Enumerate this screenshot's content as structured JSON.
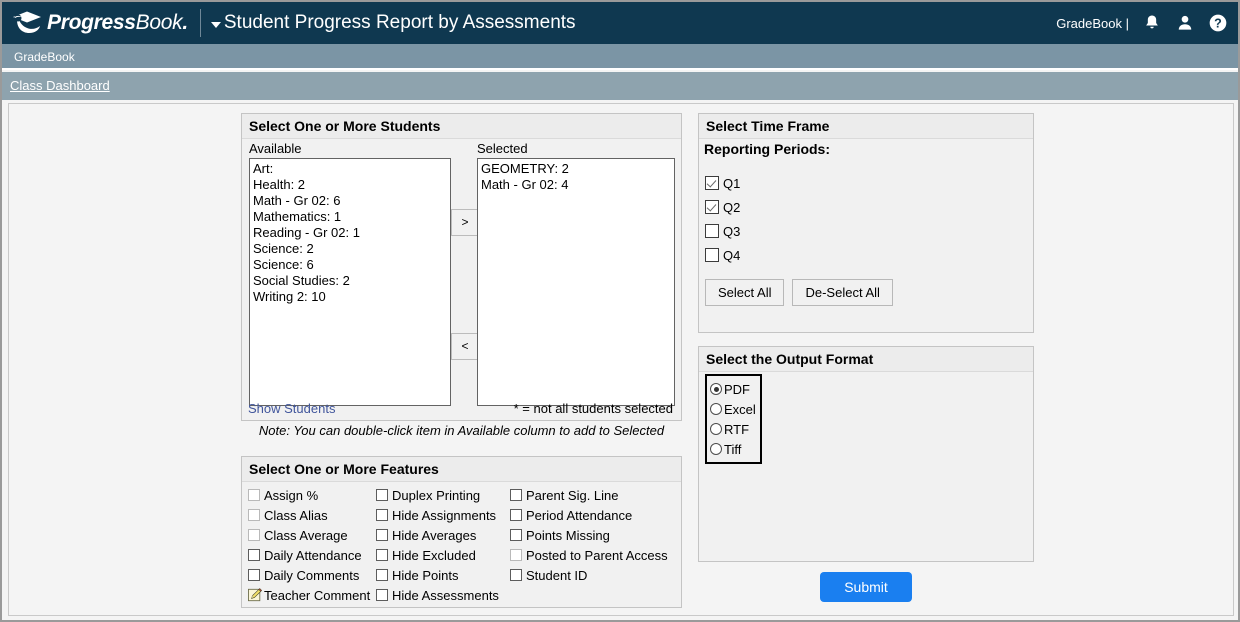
{
  "header": {
    "brand_primary": "Progress",
    "brand_secondary": "Book",
    "brand_dot": ".",
    "title": "Student Progress Report by Assessments",
    "user_label": "GradeBook |",
    "icons": [
      "bell-icon",
      "user-icon",
      "help-icon"
    ],
    "bar_color": "#0f3850"
  },
  "subbar": {
    "label": "GradeBook",
    "color": "#7b95a5"
  },
  "breadcrumb": {
    "label": "Class Dashboard",
    "color": "#8ea3ae"
  },
  "students": {
    "panel_title": "Select One or More Students",
    "available_label": "Available",
    "selected_label": "Selected",
    "available": [
      "Art:",
      "Health: 2",
      "Math - Gr 02: 6",
      "Mathematics: 1",
      "Reading - Gr 02: 1",
      "Science: 2",
      "Science: 6",
      "Social Studies: 2",
      "Writing 2: 10"
    ],
    "selected": [
      "GEOMETRY: 2",
      "Math - Gr 02: 4"
    ],
    "add_button": ">",
    "remove_button": "<",
    "show_students_link": "Show Students",
    "legend": "* = not all students selected",
    "note": "Note: You can double-click item in Available column to add to Selected"
  },
  "features": {
    "panel_title": "Select One or More Features",
    "columns": [
      [
        {
          "label": "Assign %",
          "type": "checkbox",
          "checked": false,
          "dim": true
        },
        {
          "label": "Class Alias",
          "type": "checkbox",
          "checked": false,
          "dim": true
        },
        {
          "label": "Class Average",
          "type": "checkbox",
          "checked": false,
          "dim": true
        },
        {
          "label": "Daily Attendance",
          "type": "checkbox",
          "checked": false,
          "dim": false
        },
        {
          "label": "Daily Comments",
          "type": "checkbox",
          "checked": false,
          "dim": false
        },
        {
          "label": "Teacher Comment",
          "type": "note-icon",
          "checked": false,
          "dim": false
        }
      ],
      [
        {
          "label": "Duplex Printing",
          "type": "checkbox",
          "checked": false,
          "dim": false
        },
        {
          "label": "Hide Assignments",
          "type": "checkbox",
          "checked": false,
          "dim": false
        },
        {
          "label": "Hide Averages",
          "type": "checkbox",
          "checked": false,
          "dim": false
        },
        {
          "label": "Hide Excluded",
          "type": "checkbox",
          "checked": false,
          "dim": false
        },
        {
          "label": "Hide Points",
          "type": "checkbox",
          "checked": false,
          "dim": false
        },
        {
          "label": "Hide Assessments",
          "type": "checkbox",
          "checked": false,
          "dim": false
        }
      ],
      [
        {
          "label": "Parent Sig. Line",
          "type": "checkbox",
          "checked": false,
          "dim": false
        },
        {
          "label": "Period Attendance",
          "type": "checkbox",
          "checked": false,
          "dim": false
        },
        {
          "label": "Points Missing",
          "type": "checkbox",
          "checked": false,
          "dim": false
        },
        {
          "label": "Posted to Parent Access",
          "type": "checkbox",
          "checked": false,
          "dim": true
        },
        {
          "label": "Student ID",
          "type": "checkbox",
          "checked": false,
          "dim": false
        }
      ]
    ]
  },
  "timeframe": {
    "panel_title": "Select Time Frame",
    "section_label": "Reporting Periods:",
    "periods": [
      {
        "label": "Q1",
        "checked": true
      },
      {
        "label": "Q2",
        "checked": true
      },
      {
        "label": "Q3",
        "checked": false
      },
      {
        "label": "Q4",
        "checked": false
      }
    ],
    "select_all": "Select All",
    "deselect_all": "De-Select All"
  },
  "output": {
    "panel_title": "Select the Output Format",
    "options": [
      {
        "label": "PDF",
        "checked": true
      },
      {
        "label": "Excel",
        "checked": false
      },
      {
        "label": "RTF",
        "checked": false
      },
      {
        "label": "Tiff",
        "checked": false
      }
    ]
  },
  "actions": {
    "submit_label": "Submit",
    "submit_color": "#1a7ff0"
  }
}
